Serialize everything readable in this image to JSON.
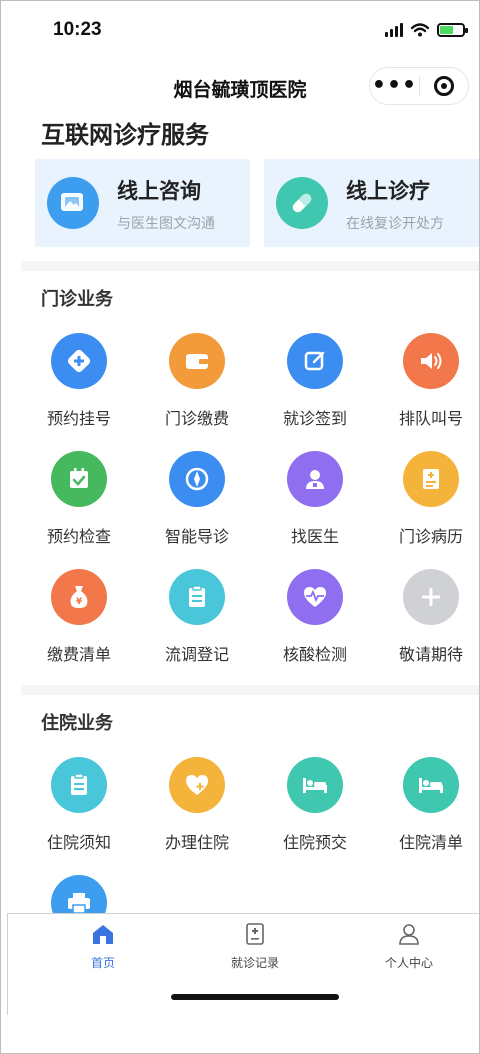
{
  "status_bar": {
    "time": "10:23"
  },
  "header": {
    "title": "烟台毓璜顶医院",
    "more_glyph": "•••"
  },
  "internet_services": {
    "title": "互联网诊疗服务",
    "cards": [
      {
        "title": "线上咨询",
        "subtitle": "与医生图文沟通",
        "icon": "image-chat-icon",
        "color": "#3d9ef0"
      },
      {
        "title": "线上诊疗",
        "subtitle": "在线复诊开处方",
        "icon": "pill-icon",
        "color": "#3fc7b0"
      }
    ]
  },
  "outpatient": {
    "title": "门诊业务",
    "items": [
      {
        "label": "预约挂号",
        "icon": "hospital-cross-icon",
        "color": "#3b8df1"
      },
      {
        "label": "门诊缴费",
        "icon": "wallet-icon",
        "color": "#f39a3a"
      },
      {
        "label": "就诊签到",
        "icon": "edit-icon",
        "color": "#3b8df1"
      },
      {
        "label": "排队叫号",
        "icon": "speaker-icon",
        "color": "#f2784b"
      },
      {
        "label": "预约检查",
        "icon": "calendar-check-icon",
        "color": "#46b85d"
      },
      {
        "label": "智能导诊",
        "icon": "compass-icon",
        "color": "#3b8df1"
      },
      {
        "label": "找医生",
        "icon": "doctor-icon",
        "color": "#8f6ef0"
      },
      {
        "label": "门诊病历",
        "icon": "medical-record-icon",
        "color": "#f4b43c"
      },
      {
        "label": "缴费清单",
        "icon": "money-bag-icon",
        "color": "#f2784b"
      },
      {
        "label": "流调登记",
        "icon": "clipboard-icon",
        "color": "#49c6d9"
      },
      {
        "label": "核酸检测",
        "icon": "heart-pulse-icon",
        "color": "#8f6ef0"
      },
      {
        "label": "敬请期待",
        "icon": "plus-icon",
        "color": "#cfd1d4"
      }
    ]
  },
  "inpatient": {
    "title": "住院业务",
    "items": [
      {
        "label": "住院须知",
        "icon": "clipboard-icon",
        "color": "#49c6d9"
      },
      {
        "label": "办理住院",
        "icon": "heart-plus-icon",
        "color": "#f4b43c"
      },
      {
        "label": "住院预交",
        "icon": "bed-icon",
        "color": "#3fc7b0"
      },
      {
        "label": "住院清单",
        "icon": "bed-icon",
        "color": "#3fc7b0"
      },
      {
        "label": "",
        "icon": "printer-icon",
        "color": "#3d9ef0"
      }
    ]
  },
  "tabbar": {
    "tabs": [
      {
        "label": "首页",
        "icon": "home-icon",
        "active": true
      },
      {
        "label": "就诊记录",
        "icon": "record-icon",
        "active": false
      },
      {
        "label": "个人中心",
        "icon": "user-icon",
        "active": false
      }
    ],
    "active_color": "#3a74e0"
  }
}
